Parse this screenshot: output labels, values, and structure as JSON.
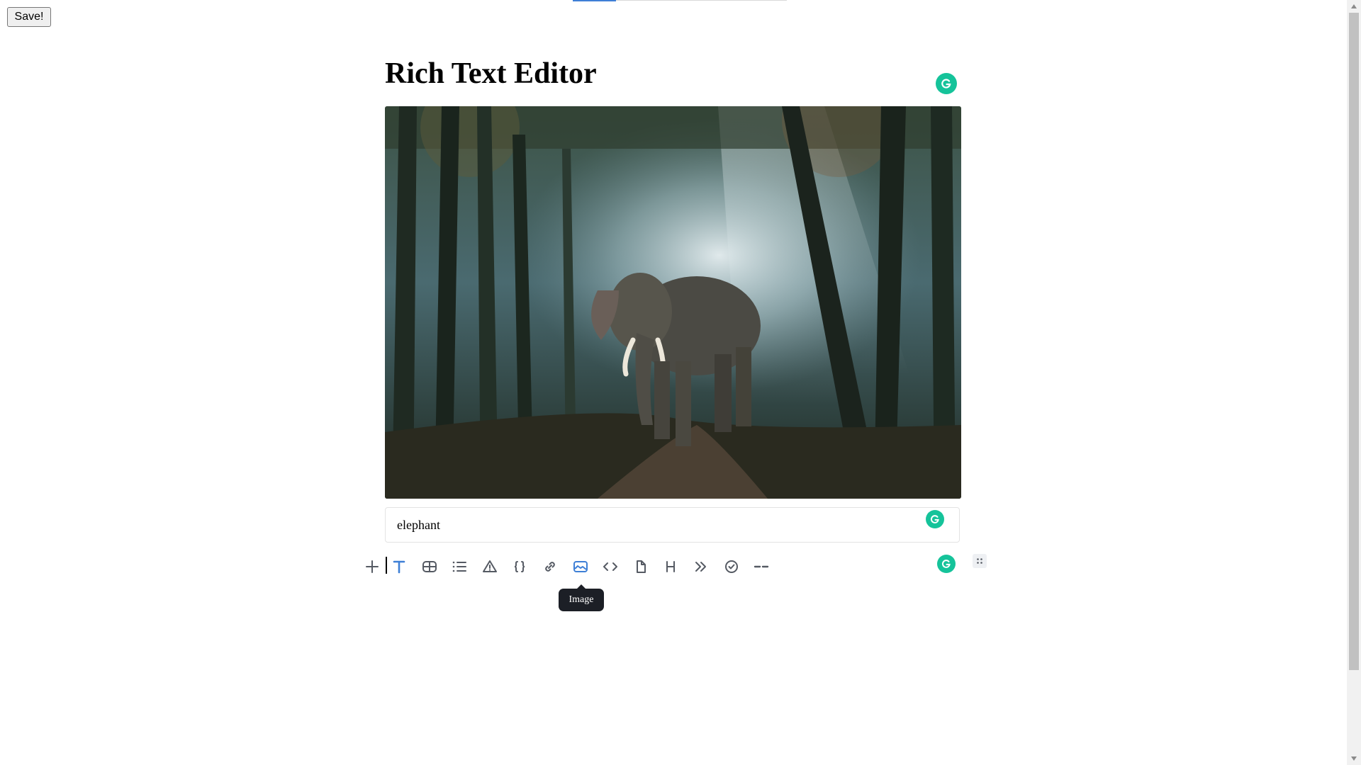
{
  "toolbar_top": {
    "save_label": "Save!"
  },
  "editor": {
    "title": "Rich Text Editor",
    "image": {
      "caption": "elephant"
    }
  },
  "block_toolbar": {
    "tools": [
      {
        "icon": "plus-icon"
      },
      {
        "icon": "text-icon",
        "active": true
      },
      {
        "icon": "table-icon"
      },
      {
        "icon": "list-icon"
      },
      {
        "icon": "warning-icon"
      },
      {
        "icon": "braces-icon"
      },
      {
        "icon": "link-icon"
      },
      {
        "icon": "image-icon",
        "hovered": true
      },
      {
        "icon": "code-icon"
      },
      {
        "icon": "file-icon"
      },
      {
        "icon": "heading-icon"
      },
      {
        "icon": "quote-icon"
      },
      {
        "icon": "checklist-icon"
      },
      {
        "icon": "delimiter-icon"
      }
    ],
    "tooltip": "Image"
  },
  "colors": {
    "accent": "#3e7fd6",
    "grammarly": "#15c39a",
    "icon": "#555a63",
    "tooltip_bg": "#1c1f26"
  }
}
